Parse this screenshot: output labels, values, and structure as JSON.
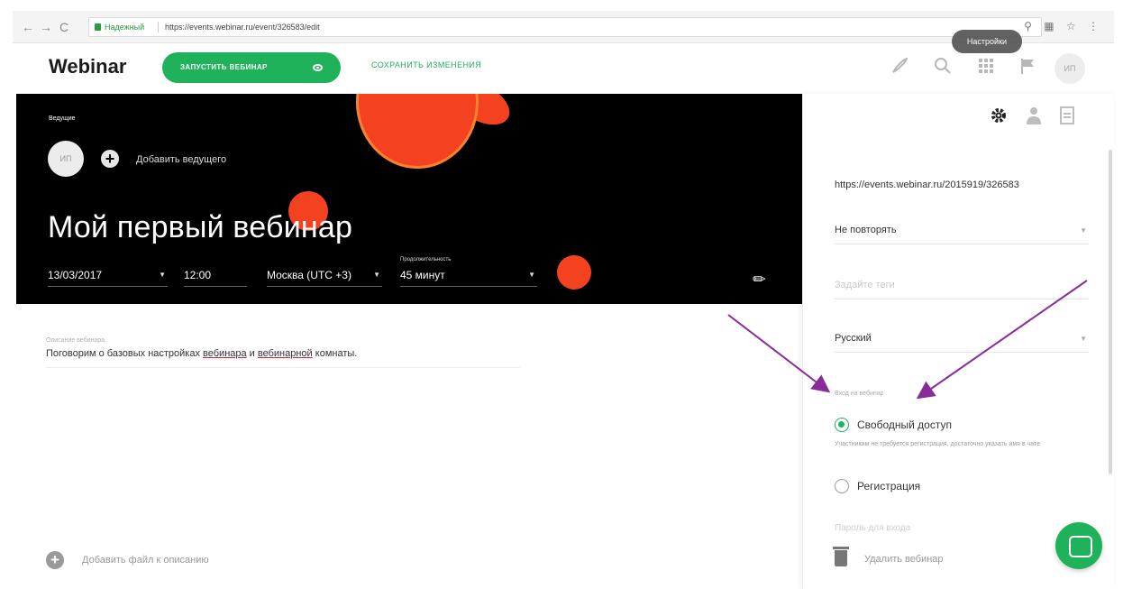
{
  "browser": {
    "back": "←",
    "forward": "→",
    "reload": "C",
    "secure_label": "Надежный",
    "url": "https://events.webinar.ru/event/326583/edit",
    "right_icons": "⚲ ▦ ☆ ⋮"
  },
  "header": {
    "logo": "Webinar",
    "start_button": "ЗАПУСТИТЬ ВЕБИНАР",
    "save_button": "СОХРАНИТЬ ИЗМЕНЕНИЯ",
    "avatar_initials": "ИП",
    "tooltip": "Настройки"
  },
  "hero": {
    "hosts_label": "Ведущие",
    "host_initials": "ИП",
    "add_host": "Добавить ведущего",
    "title": "Мой первый вебинар",
    "date": "13/03/2017",
    "time": "12:00",
    "timezone": "Москва (UTC +3)",
    "duration_label": "Продолжительность",
    "duration": "45 минут"
  },
  "main": {
    "description_label": "Описание вебинара",
    "description_before": "Поговорим о базовых настройках ",
    "description_word1": "вебинара",
    "description_mid": " и ",
    "description_word2": "вебинарной",
    "description_after": " комнаты.",
    "add_file": "Добавить файл к описанию"
  },
  "sidebar": {
    "url": "https://events.webinar.ru/2015919/326583",
    "repeat": "Не повторять",
    "tags_placeholder": "Задайте теги",
    "language": "Русский",
    "entry_label": "Вход на вебинар",
    "option_free": "Свободный доступ",
    "option_free_hint": "Участникам не требуется регистрация, достаточно указать имя в чате",
    "option_registration": "Регистрация",
    "password_label": "Пароль для входа",
    "delete": "Удалить вебинар"
  },
  "colors": {
    "accent_green": "#1fb25a",
    "hero_bg": "#000000",
    "blob_red": "#f4411f",
    "arrow_purple": "#8a2b9c"
  }
}
